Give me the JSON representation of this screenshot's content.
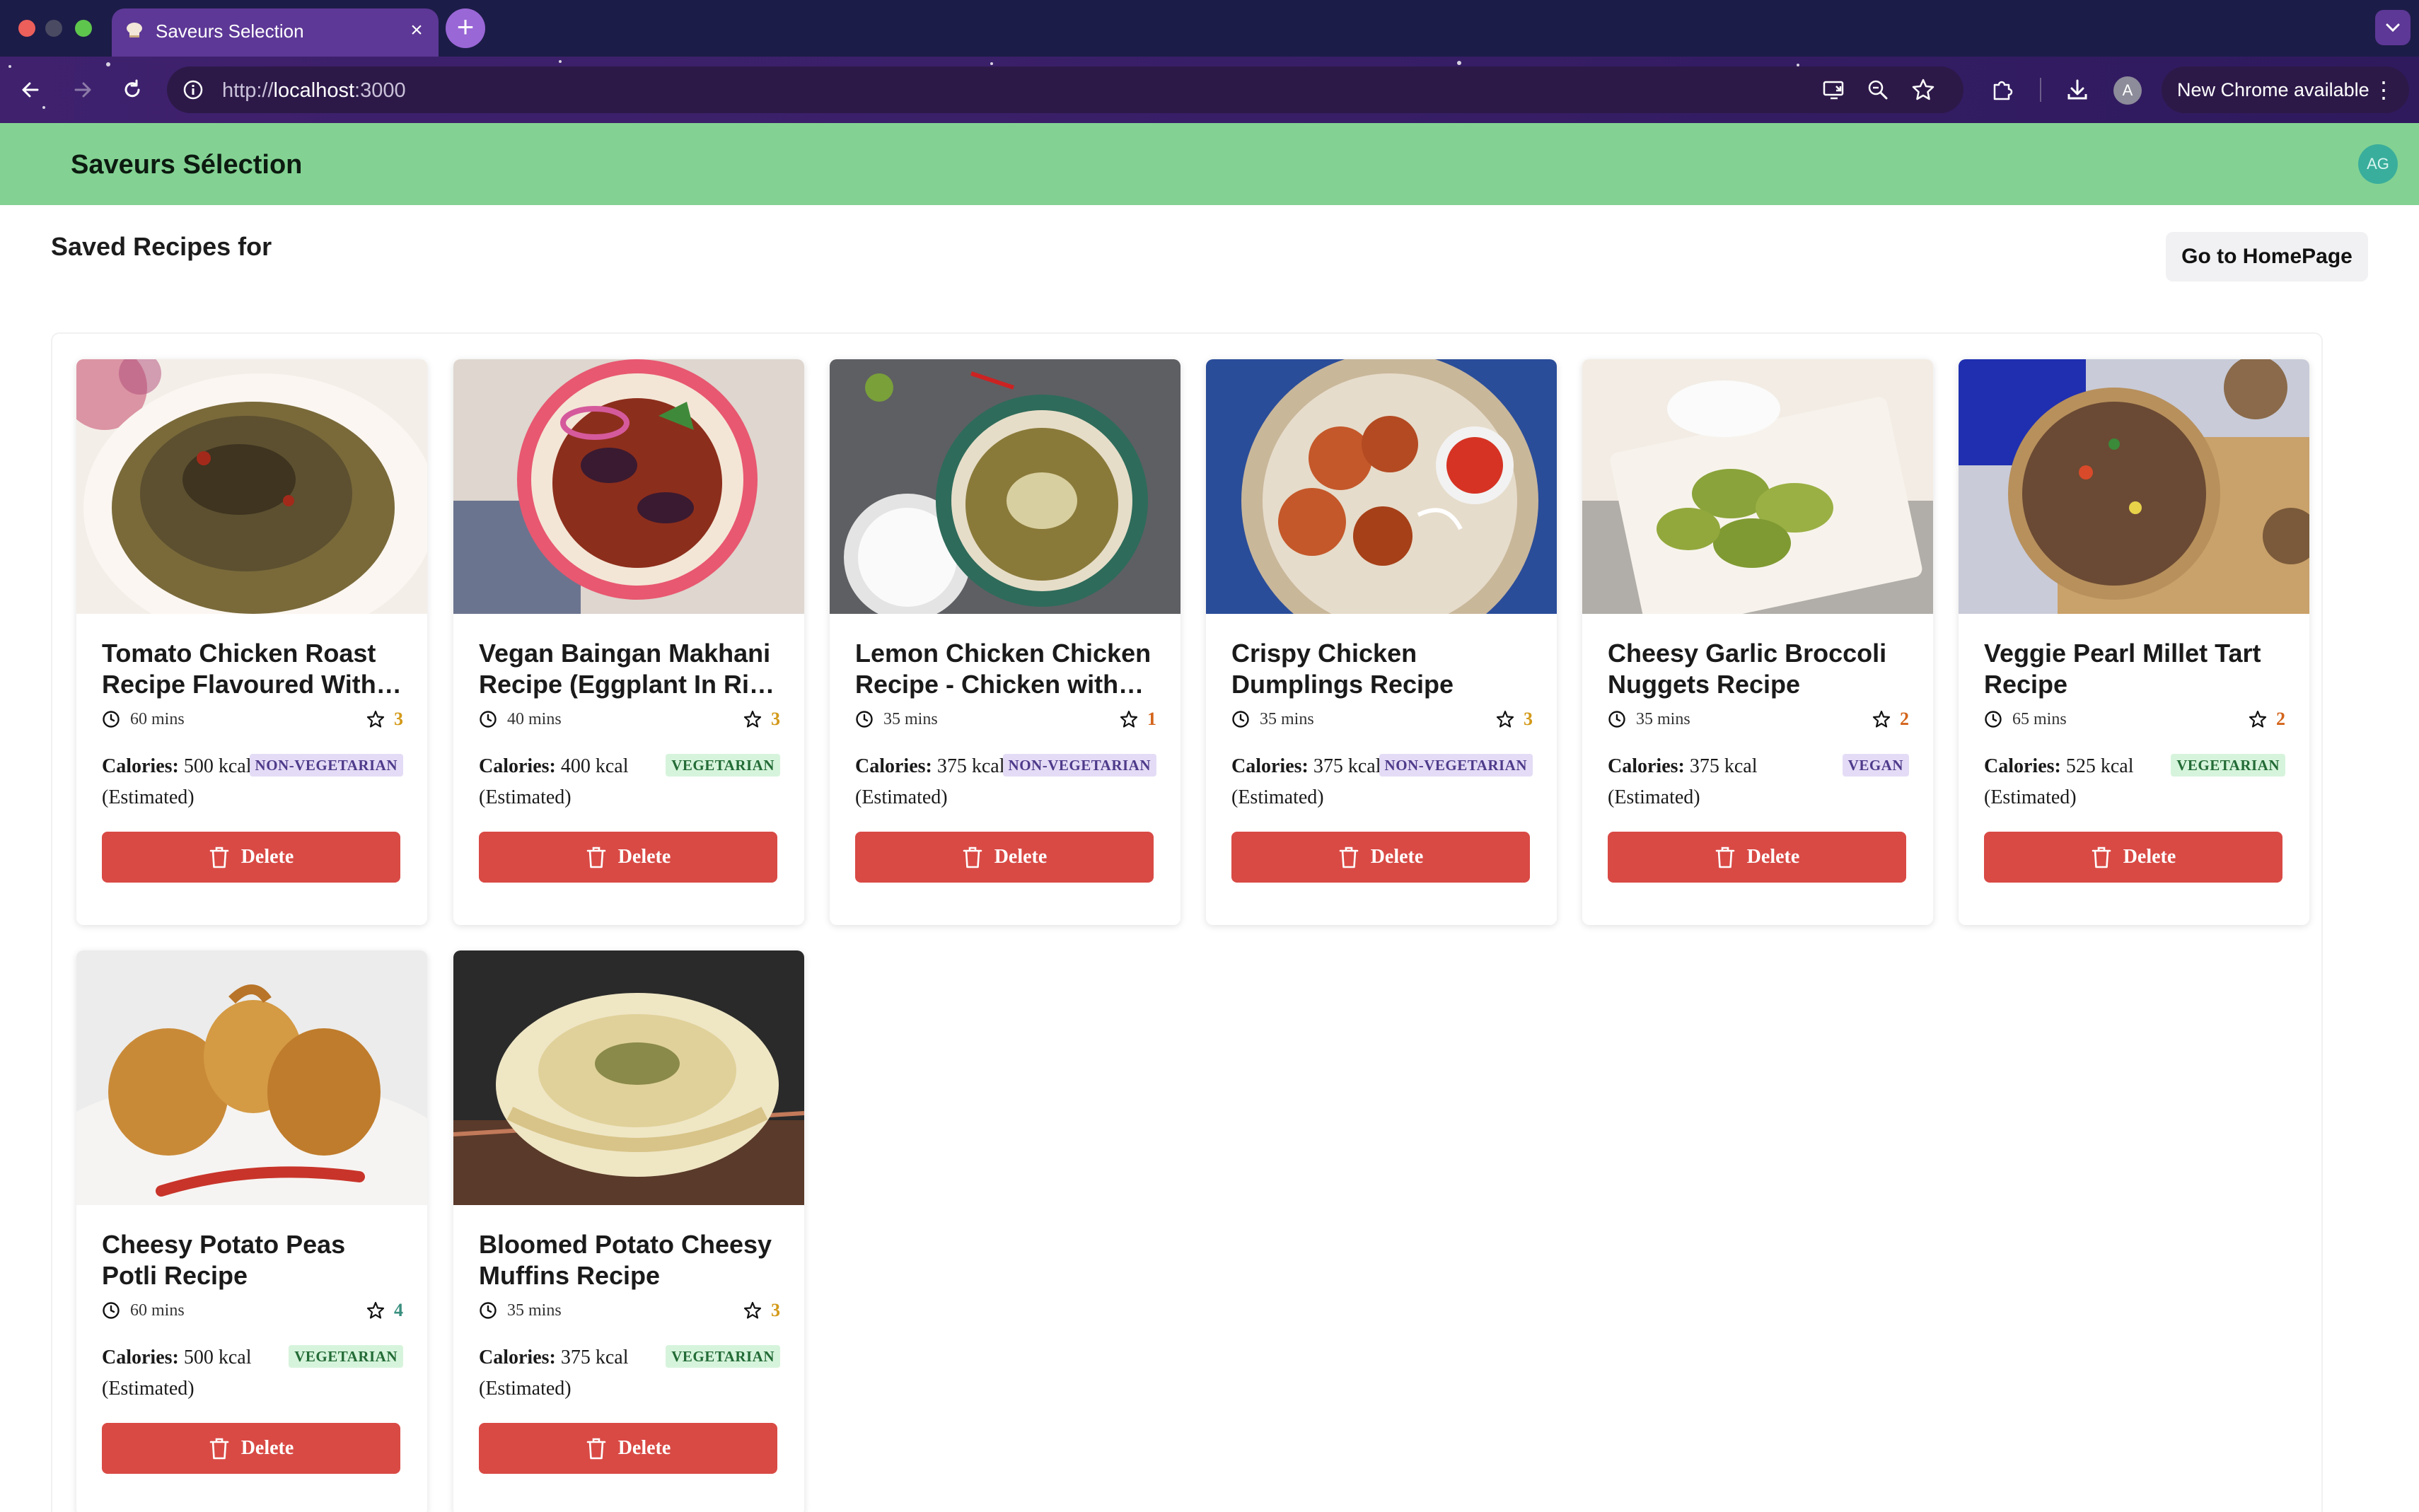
{
  "browser": {
    "tab_title": "Saveurs Selection",
    "tab_close": "×",
    "new_tab": "+",
    "url_prefix": "http://",
    "url_host": "localhost",
    "url_port": ":3000",
    "profile_initial": "A",
    "update_label": "New Chrome available",
    "update_menu": "⋮"
  },
  "header": {
    "title": "Saveurs Sélection",
    "avatar_initials": "AG"
  },
  "page": {
    "heading": "Saved Recipes for",
    "home_button": "Go to HomePage"
  },
  "recipes": [
    {
      "title": "Tomato Chicken Roast Recipe Flavoured With Fennel",
      "time": "60 mins",
      "rating": "3",
      "rating_color": "#d39a1a",
      "calories_label": "Calories:",
      "calories": "500 kcal (Estimated)",
      "diet": "NON-VEGETARIAN",
      "diet_kind": "nonveg",
      "delete_label": "Delete",
      "image": "roast-chicken"
    },
    {
      "title": "Vegan Baingan Makhani Recipe (Eggplant In Rich Gravy)",
      "time": "40 mins",
      "rating": "3",
      "rating_color": "#d39a1a",
      "calories_label": "Calories:",
      "calories": "400 kcal (Estimated)",
      "diet": "VEGETARIAN",
      "diet_kind": "veg",
      "delete_label": "Delete",
      "image": "eggplant-curry"
    },
    {
      "title": "Lemon Chicken Chicken Recipe - Chicken with Lemon",
      "time": "35 mins",
      "rating": "1",
      "rating_color": "#d3641a",
      "calories_label": "Calories:",
      "calories": "375 kcal (Estimated)",
      "diet": "NON-VEGETARIAN",
      "diet_kind": "nonveg",
      "delete_label": "Delete",
      "image": "lemon-chicken"
    },
    {
      "title": "Crispy Chicken Dumplings Recipe",
      "time": "35 mins",
      "rating": "3",
      "rating_color": "#d39a1a",
      "calories_label": "Calories:",
      "calories": "375 kcal (Estimated)",
      "diet": "NON-VEGETARIAN",
      "diet_kind": "nonveg",
      "delete_label": "Delete",
      "image": "fried-chicken"
    },
    {
      "title": "Cheesy Garlic Broccoli Nuggets Recipe",
      "time": "35 mins",
      "rating": "2",
      "rating_color": "#d3641a",
      "calories_label": "Calories:",
      "calories": "375 kcal (Estimated)",
      "diet": "VEGAN",
      "diet_kind": "vegan",
      "delete_label": "Delete",
      "image": "broccoli-nuggets"
    },
    {
      "title": "Veggie Pearl Millet Tart Recipe",
      "time": "65 mins",
      "rating": "2",
      "rating_color": "#d3641a",
      "calories_label": "Calories:",
      "calories": "525 kcal (Estimated)",
      "diet": "VEGETARIAN",
      "diet_kind": "veg",
      "delete_label": "Delete",
      "image": "millet-tart"
    },
    {
      "title": "Cheesy Potato Peas Potli Recipe",
      "time": "60 mins",
      "rating": "4",
      "rating_color": "#3a8f7f",
      "calories_label": "Calories:",
      "calories": "500 kcal (Estimated)",
      "diet": "VEGETARIAN",
      "diet_kind": "veg",
      "delete_label": "Delete",
      "image": "potli"
    },
    {
      "title": "Bloomed Potato Cheesy Muffins Recipe",
      "time": "35 mins",
      "rating": "3",
      "rating_color": "#d39a1a",
      "calories_label": "Calories:",
      "calories": "375 kcal (Estimated)",
      "diet": "VEGETARIAN",
      "diet_kind": "veg",
      "delete_label": "Delete",
      "image": "potato-muffin"
    }
  ]
}
